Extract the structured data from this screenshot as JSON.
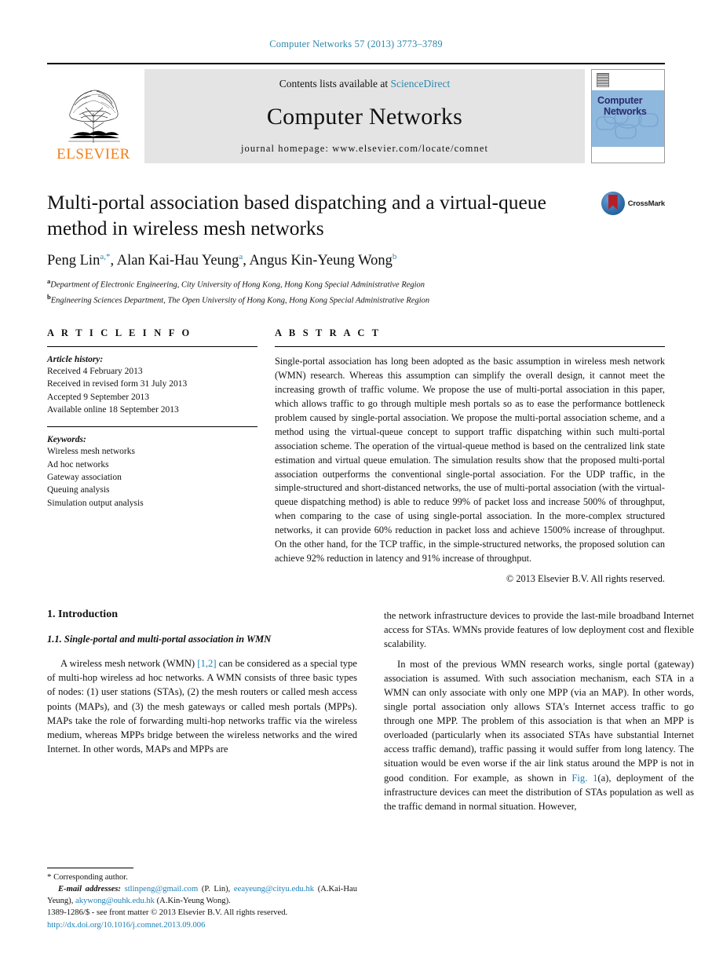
{
  "running_head": "Computer Networks 57 (2013) 3773–3789",
  "masthead": {
    "publisher": "ELSEVIER",
    "contents_prefix": "Contents lists available at",
    "contents_link": "ScienceDirect",
    "journal_name": "Computer Networks",
    "homepage": "journal homepage: www.elsevier.com/locate/comnet",
    "cover_title_line1": "Computer",
    "cover_title_line2": "Networks"
  },
  "article": {
    "title": "Multi-portal association based dispatching and a virtual-queue method in wireless mesh networks",
    "crossmark_label": "CrossMark",
    "authors": "Peng Lin, Alan Kai-Hau Yeung, Angus Kin-Yeung Wong",
    "author_parts": [
      {
        "name": "Peng Lin",
        "sup": "a,*"
      },
      {
        "name": "Alan Kai-Hau Yeung",
        "sup": "a"
      },
      {
        "name": "Angus Kin-Yeung Wong",
        "sup": "b"
      }
    ],
    "affiliations": [
      {
        "marker": "a",
        "text": "Department of Electronic Engineering, City University of Hong Kong, Hong Kong Special Administrative Region"
      },
      {
        "marker": "b",
        "text": "Engineering Sciences Department, The Open University of Hong Kong, Hong Kong Special Administrative Region"
      }
    ]
  },
  "info": {
    "heading": "A R T I C L E    I N F O",
    "history_label": "Article history:",
    "history": [
      "Received 4 February 2013",
      "Received in revised form 31 July 2013",
      "Accepted 9 September 2013",
      "Available online 18 September 2013"
    ],
    "keywords_label": "Keywords:",
    "keywords": [
      "Wireless mesh networks",
      "Ad hoc networks",
      "Gateway association",
      "Queuing analysis",
      "Simulation output analysis"
    ]
  },
  "abstract": {
    "heading": "A B S T R A C T",
    "text": "Single-portal association has long been adopted as the basic assumption in wireless mesh network (WMN) research. Whereas this assumption can simplify the overall design, it cannot meet the increasing growth of traffic volume. We propose the use of multi-portal association in this paper, which allows traffic to go through multiple mesh portals so as to ease the performance bottleneck problem caused by single-portal association. We propose the multi-portal association scheme, and a method using the virtual-queue concept to support traffic dispatching within such multi-portal association scheme. The operation of the virtual-queue method is based on the centralized link state estimation and virtual queue emulation. The simulation results show that the proposed multi-portal association outperforms the conventional single-portal association. For the UDP traffic, in the simple-structured and short-distanced networks, the use of multi-portal association (with the virtual-queue dispatching method) is able to reduce 99% of packet loss and increase 500% of throughput, when comparing to the case of using single-portal association. In the more-complex structured networks, it can provide 60% reduction in packet loss and achieve 1500% increase of throughput. On the other hand, for the TCP traffic, in the simple-structured networks, the proposed solution can achieve 92% reduction in latency and 91% increase of throughput.",
    "copyright": "© 2013 Elsevier B.V. All rights reserved."
  },
  "body": {
    "section_heading": "1. Introduction",
    "subsection_heading": "1.1. Single-portal and multi-portal association in WMN",
    "left_paragraph_pre": "A wireless mesh network (WMN) ",
    "left_citation": "[1,2]",
    "left_paragraph_post": " can be considered as a special type of multi-hop wireless ad hoc networks. A WMN consists of three basic types of nodes: (1) user stations (STAs), (2) the mesh routers or called mesh access points (MAPs), and (3) the mesh gateways or called mesh portals (MPPs). MAPs take the role of forwarding multi-hop networks traffic via the wireless medium, whereas MPPs bridge between the wireless networks and the wired Internet. In other words, MAPs and MPPs are",
    "right_paragraph_1": "the network infrastructure devices to provide the last-mile broadband Internet access for STAs. WMNs provide features of low deployment cost and flexible scalability.",
    "right_paragraph_2_pre": "In most of the previous WMN research works, single portal (gateway) association is assumed. With such association mechanism, each STA in a WMN can only associate with only one MPP (via an MAP). In other words, single portal association only allows STA's Internet access traffic to go through one MPP. The problem of this association is that when an MPP is overloaded (particularly when its associated STAs have substantial Internet access traffic demand), traffic passing it would suffer from long latency. The situation would be even worse if the air link status around the MPP is not in good condition. For example, as shown in ",
    "right_figure_ref": "Fig. 1",
    "right_paragraph_2_post": "(a), deployment of the infrastructure devices can meet the distribution of STAs population as well as the traffic demand in normal situation. However,"
  },
  "footnote": {
    "star": "*",
    "corresponding": "Corresponding author.",
    "email_label": "E-mail addresses:",
    "emails": [
      {
        "address": "stlinpeng@gmail.com",
        "person": "(P. Lin)"
      },
      {
        "address": "eeayeung@cityu.edu.hk",
        "person": "(A.Kai-Hau Yeung)"
      },
      {
        "address": "akywong@ouhk.edu.hk",
        "person": "(A.Kin-Yeung Wong)"
      }
    ]
  },
  "footer": {
    "issn_line": "1389-1286/$ - see front matter © 2013 Elsevier B.V. All rights reserved.",
    "doi": "http://dx.doi.org/10.1016/j.comnet.2013.09.006"
  },
  "colors": {
    "link": "#1b7eb5",
    "running_head": "#2e86ab",
    "elsevier_orange": "#f07f1a",
    "banner_gray": "#e4e4e4",
    "cover_blue": "#8fb8de",
    "crossmark_red": "#b42025"
  }
}
